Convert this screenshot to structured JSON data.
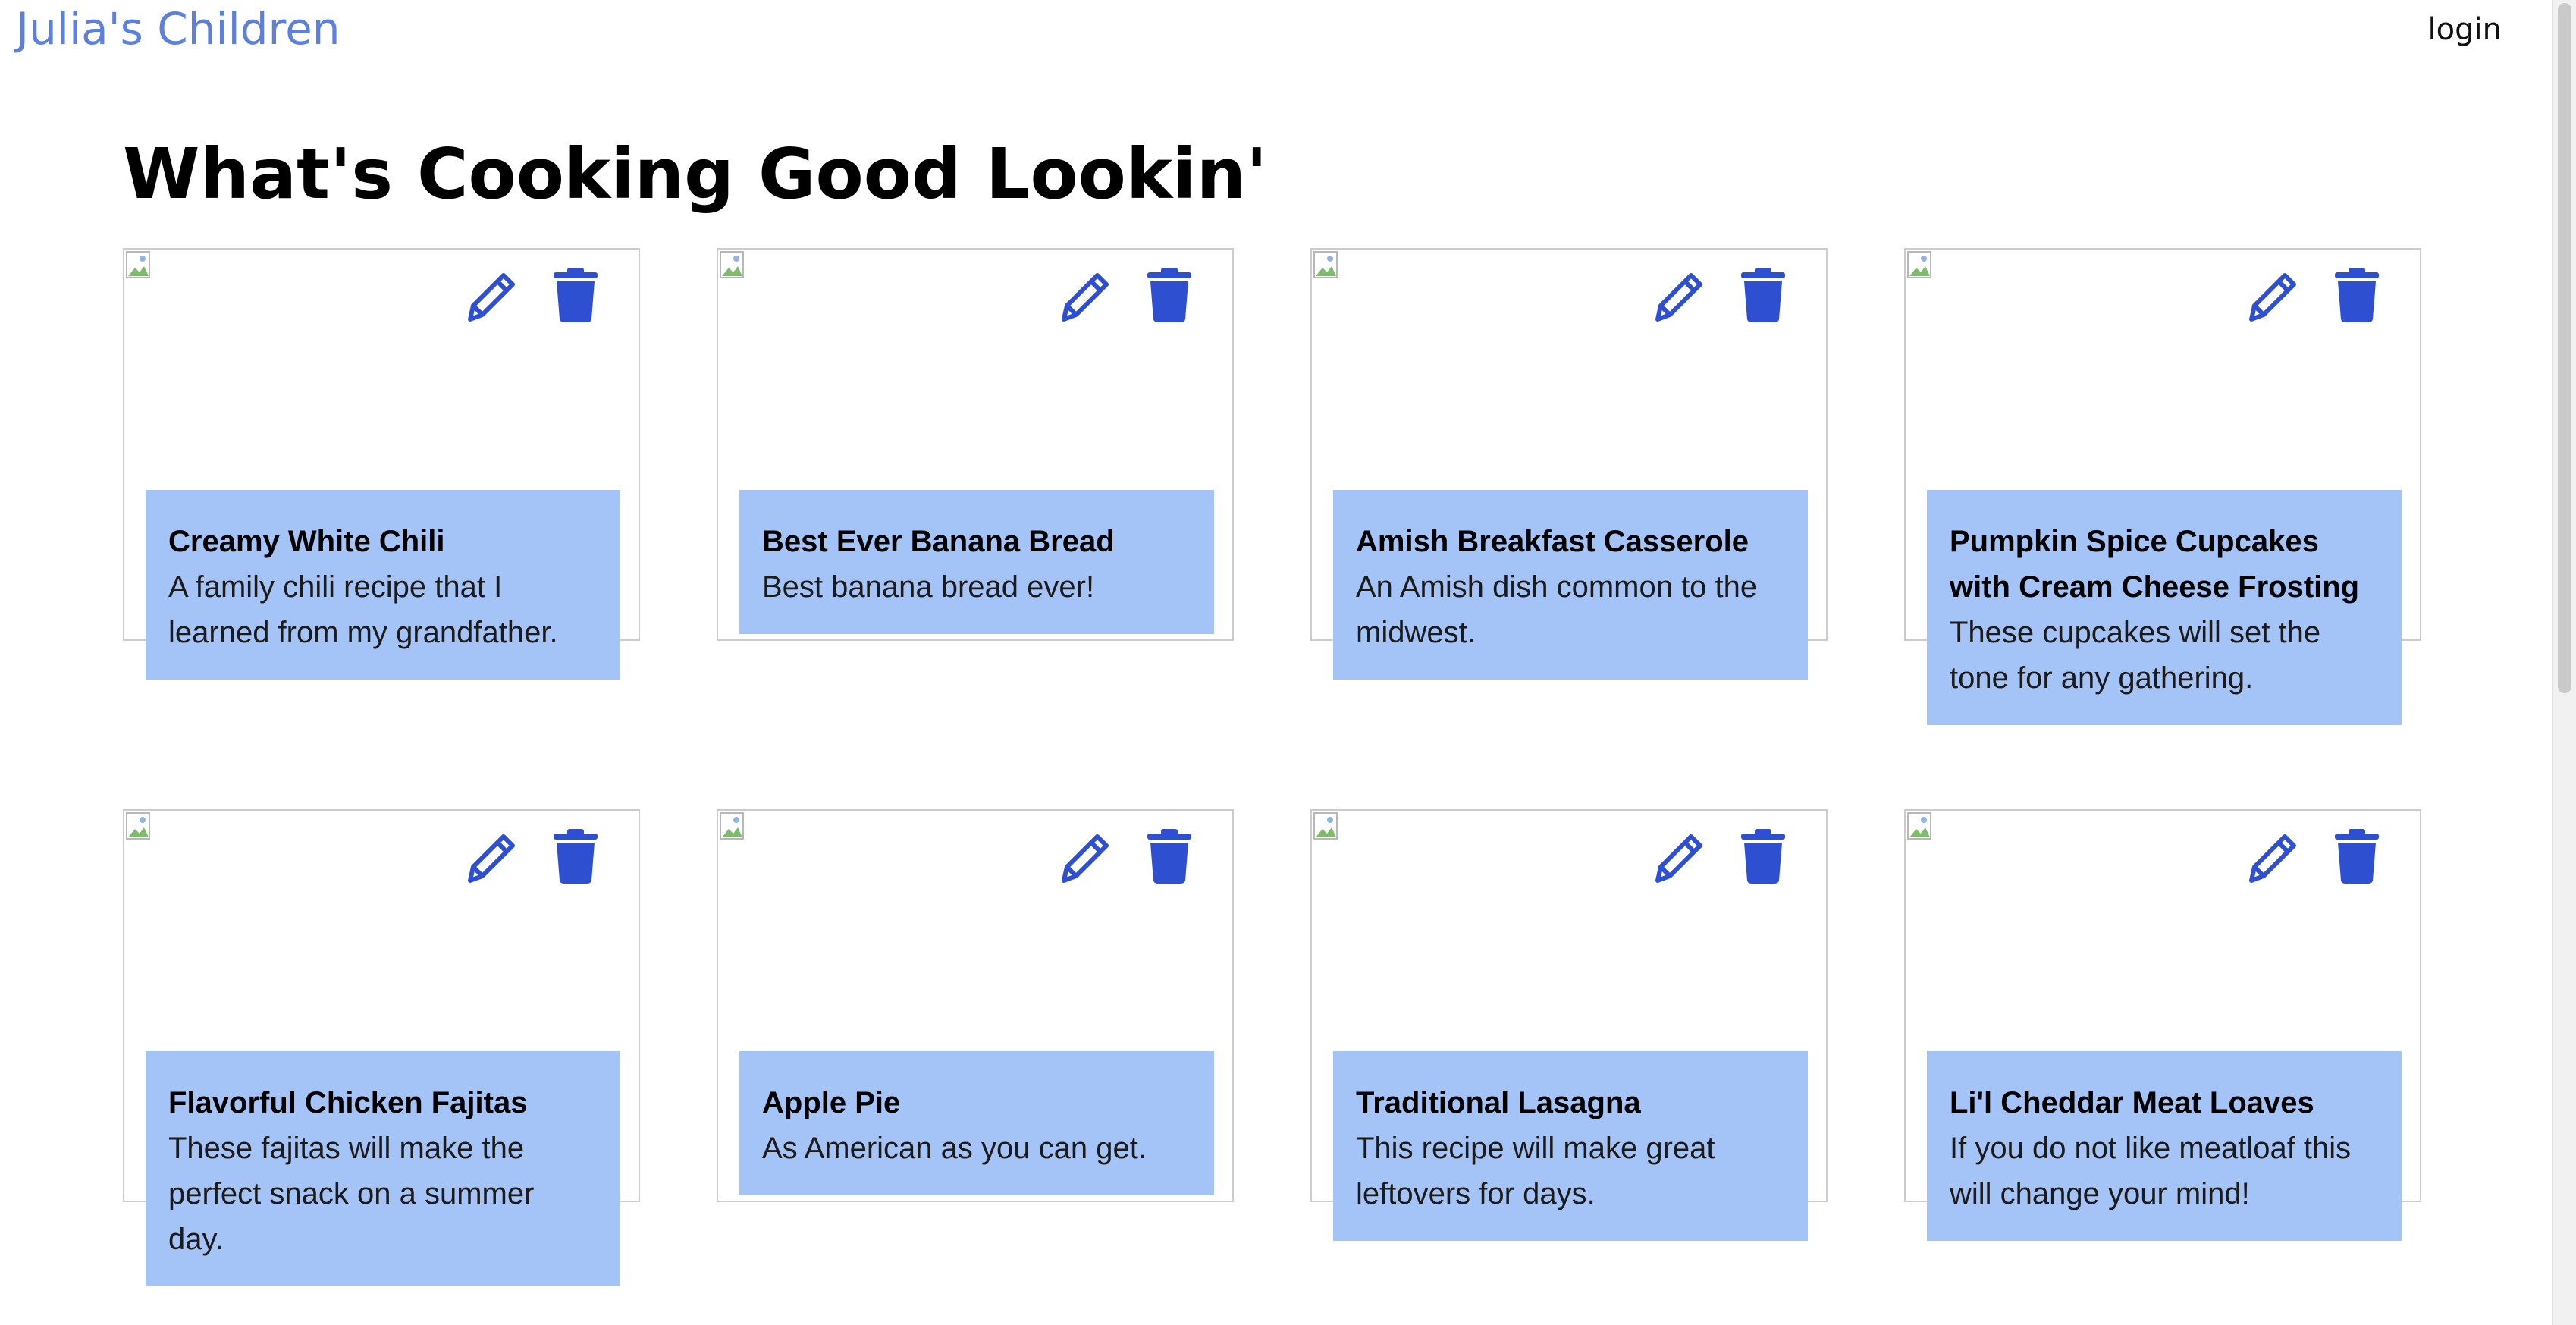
{
  "header": {
    "brand": "Julia's Children",
    "login": "login"
  },
  "main": {
    "title": "What's Cooking Good Lookin'"
  },
  "colors": {
    "brand": "#5c80dc",
    "card_info_bg": "#a4c3f7",
    "icon_blue": "#2e50d0"
  },
  "recipes": [
    {
      "title": "Creamy White Chili",
      "description": "A family chili recipe that I learned from my grandfather."
    },
    {
      "title": "Best Ever Banana Bread",
      "description": "Best banana bread ever!"
    },
    {
      "title": "Amish Breakfast Casserole",
      "description": "An Amish dish common to the midwest."
    },
    {
      "title": "Pumpkin Spice Cupcakes with Cream Cheese Frosting",
      "description": "These cupcakes will set the tone for any gathering."
    },
    {
      "title": "Flavorful Chicken Fajitas",
      "description": "These fajitas will make the perfect snack on a summer day."
    },
    {
      "title": "Apple Pie",
      "description": "As American as you can get."
    },
    {
      "title": "Traditional Lasagna",
      "description": "This recipe will make great leftovers for days."
    },
    {
      "title": "Li'l Cheddar Meat Loaves",
      "description": "If you do not like meatloaf this will change your mind!"
    }
  ],
  "icons": {
    "edit": "pencil-icon",
    "delete": "trash-icon",
    "image": "broken-image-icon"
  }
}
